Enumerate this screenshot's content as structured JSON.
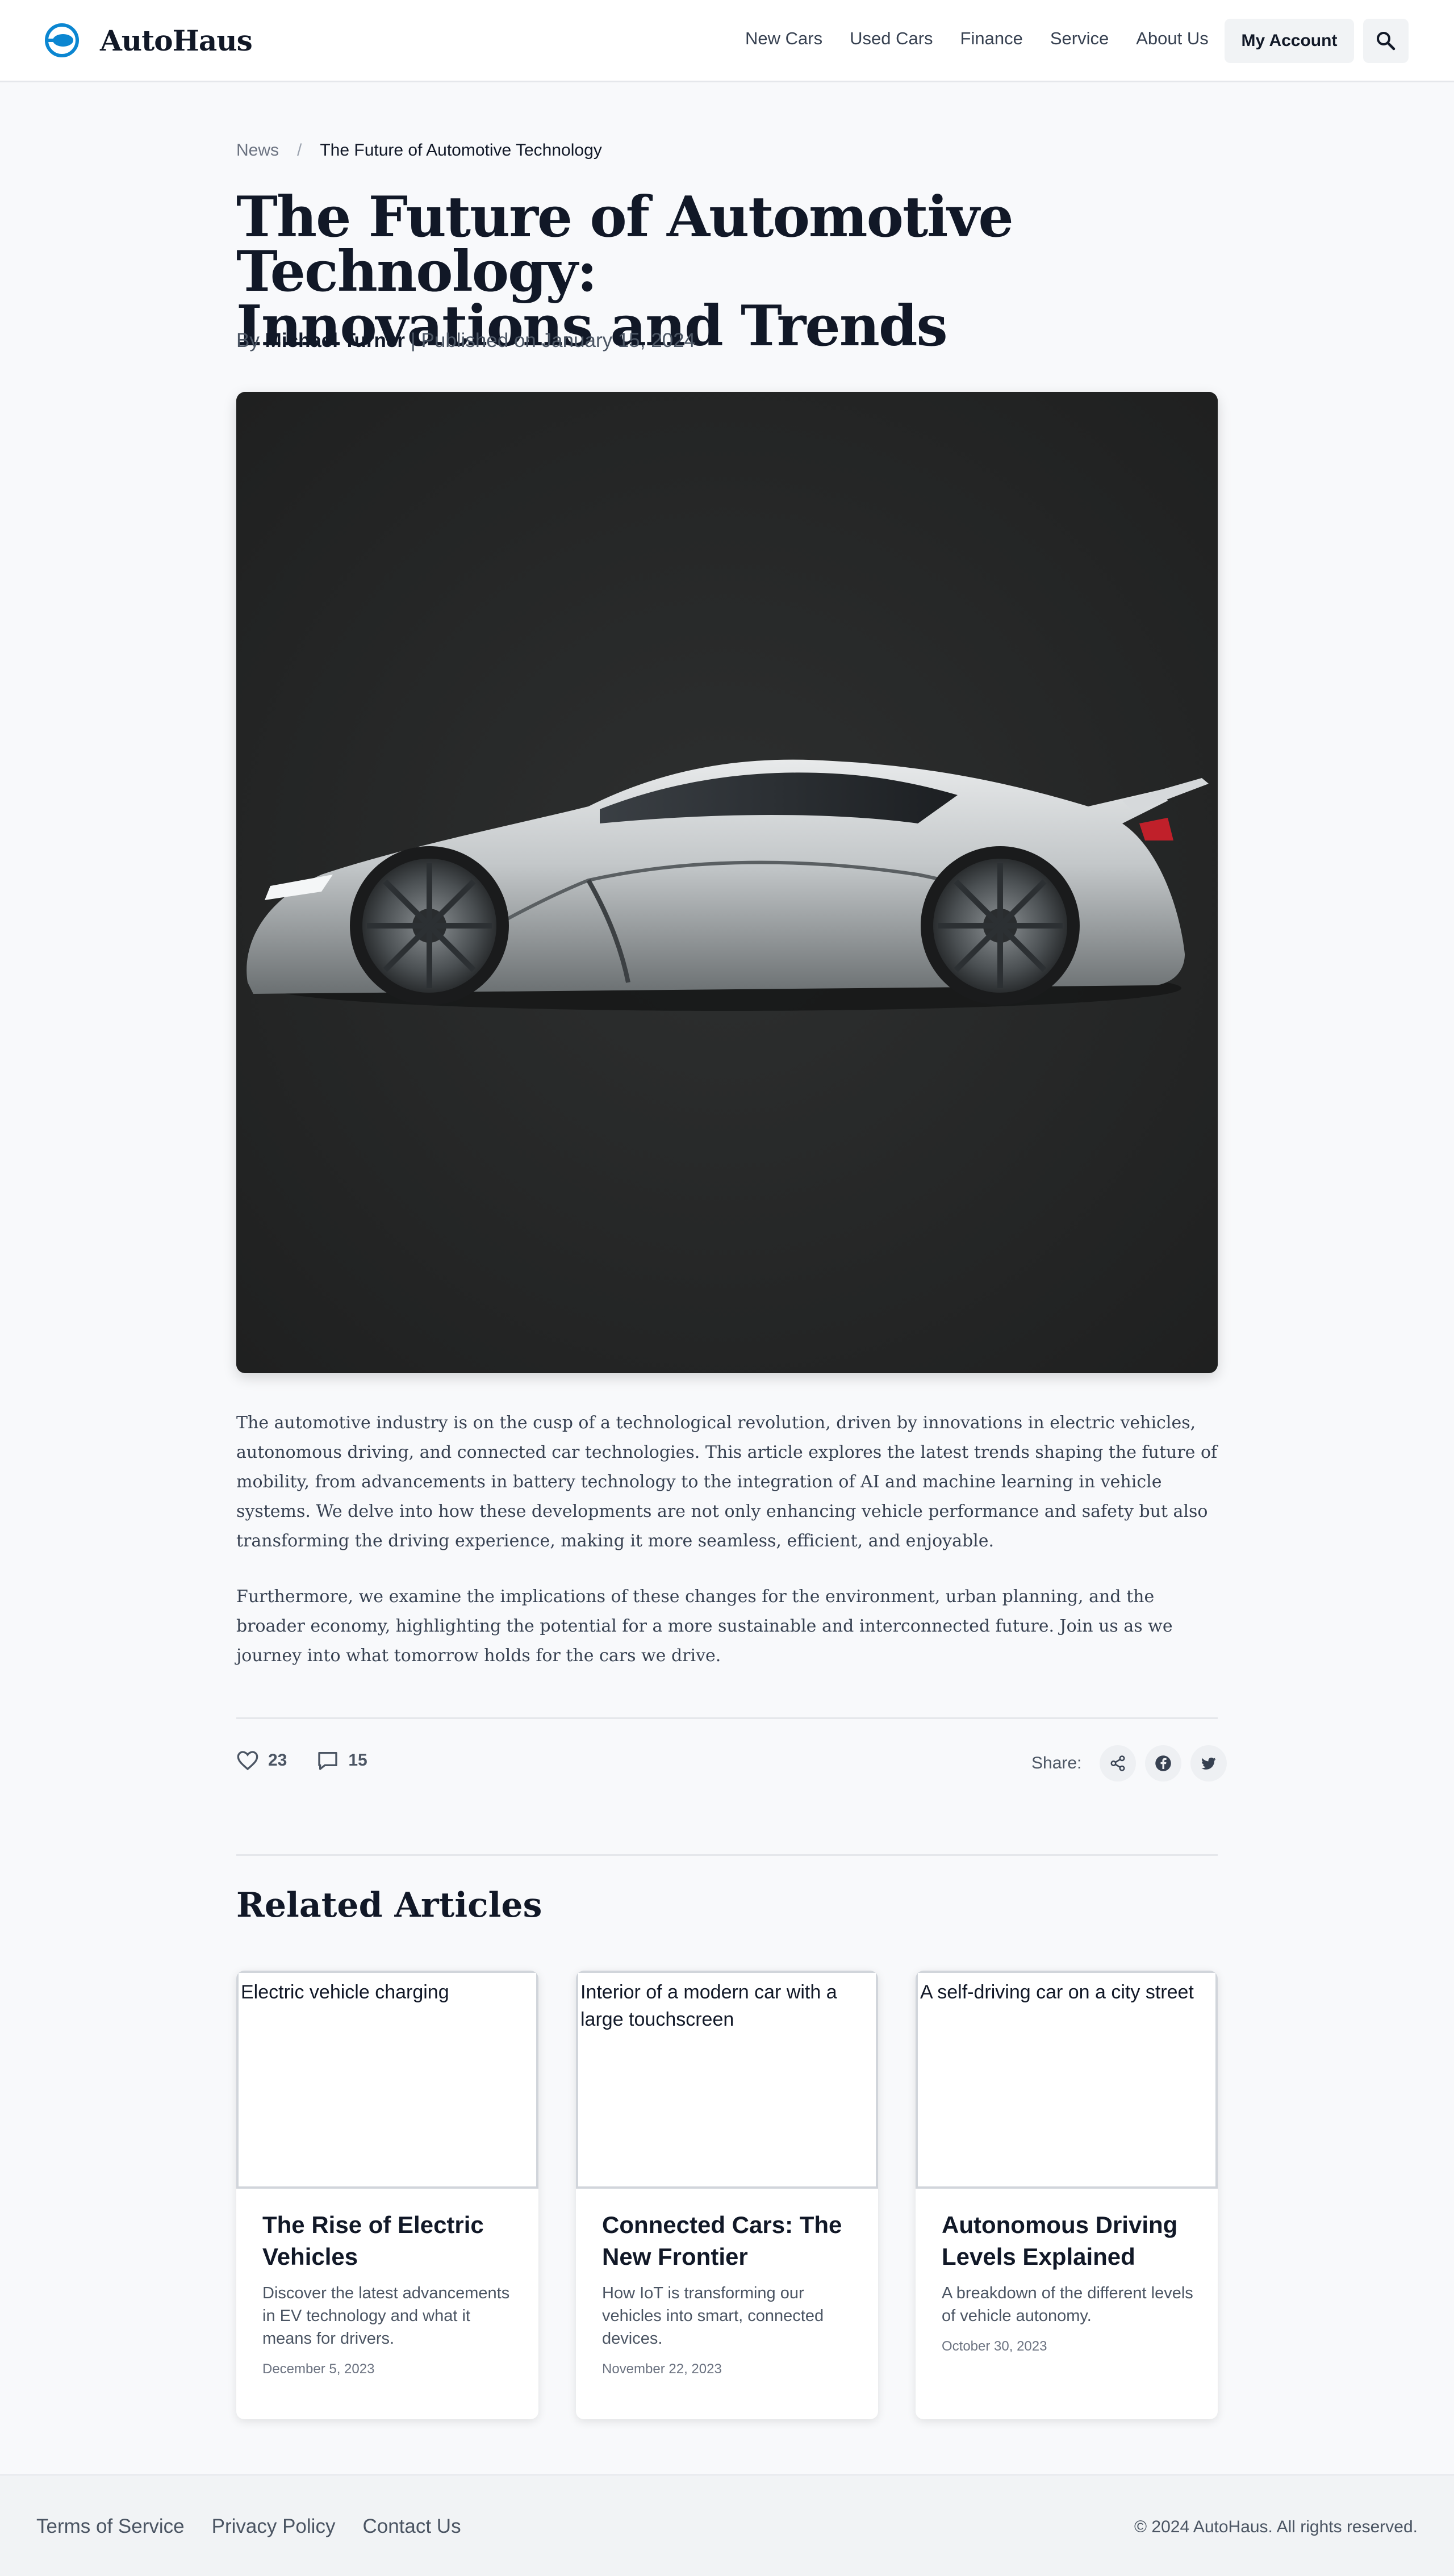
{
  "header": {
    "brand": "AutoHaus",
    "nav": [
      "New Cars",
      "Used Cars",
      "Finance",
      "Service",
      "About Us"
    ],
    "account_label": "My Account"
  },
  "breadcrumb": {
    "root": "News",
    "separator": "/",
    "current": "The Future of Automotive Technology"
  },
  "article": {
    "title_line1": "The Future of Automotive Technology:",
    "title_line2": "Innovations and Trends",
    "by_label": "By",
    "author": "Michael Turner",
    "published": "| Published on January 15, 2024",
    "paragraphs": [
      "The automotive industry is on the cusp of a technological revolution, driven by innovations in electric vehicles, autonomous driving, and connected car technologies. This article explores the latest trends shaping the future of mobility, from advancements in battery technology to the integration of AI and machine learning in vehicle systems. We delve into how these developments are not only enhancing vehicle performance and safety but also transforming the driving experience, making it more seamless, efficient, and enjoyable.",
      "Furthermore, we examine the implications of these changes for the environment, urban planning, and the broader economy, highlighting the potential for a more sustainable and interconnected future. Join us as we journey into what tomorrow holds for the cars we drive."
    ],
    "likes": "23",
    "comments": "15",
    "share_label": "Share:"
  },
  "related": {
    "heading": "Related Articles",
    "cards": [
      {
        "image_alt": "Electric vehicle charging",
        "title": "The Rise of Electric Vehicles",
        "description": "Discover the latest advancements in EV technology and what it means for drivers.",
        "date": "December 5, 2023"
      },
      {
        "image_alt": "Interior of a modern car with a large touchscreen",
        "title": "Connected Cars: The New Frontier",
        "description": "How IoT is transforming our vehicles into smart, connected devices.",
        "date": "November 22, 2023"
      },
      {
        "image_alt": "A self-driving car on a city street",
        "title": "Autonomous Driving Levels Explained",
        "description": "A breakdown of the different levels of vehicle autonomy.",
        "date": "October 30, 2023"
      }
    ]
  },
  "footer": {
    "links": [
      "Terms of Service",
      "Privacy Policy",
      "Contact Us"
    ],
    "copyright": "© 2024 AutoHaus. All rights reserved."
  },
  "colors": {
    "brand_accent": "#0b86d1",
    "text_primary": "#111827",
    "text_secondary": "#4b5563",
    "page_bg": "#f8f9fb"
  },
  "icons": [
    "autohaus-logo-icon",
    "search-icon",
    "heart-icon",
    "comment-icon",
    "share-icon",
    "facebook-icon",
    "twitter-icon"
  ]
}
